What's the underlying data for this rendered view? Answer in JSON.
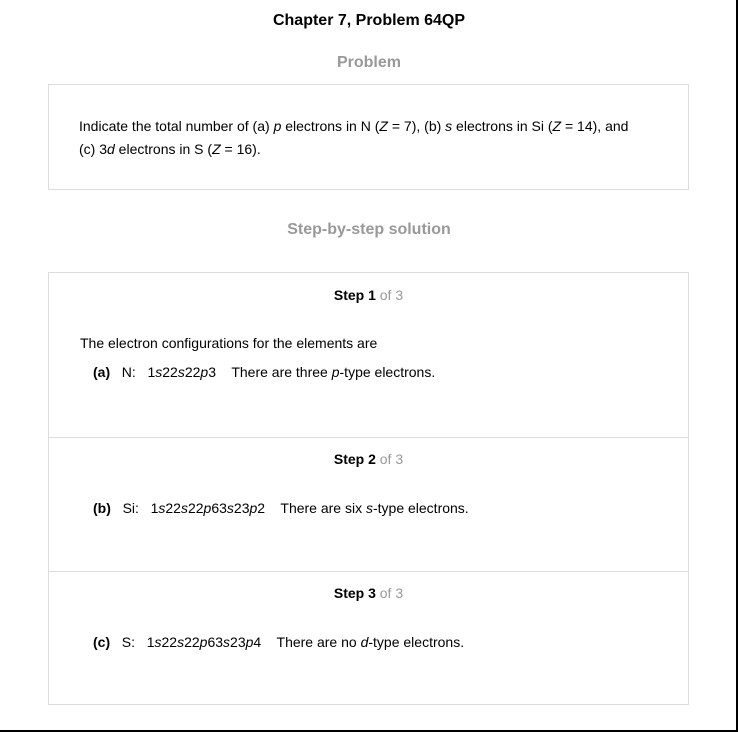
{
  "title": "Chapter 7, Problem 64QP",
  "problem_heading": "Problem",
  "problem": {
    "line1": {
      "t1": "Indicate the total number of (a) ",
      "p": "p",
      "t2": " electrons in N (",
      "z1": "Z",
      "t3": " = 7), (b) ",
      "s": "s",
      "t4": " electrons in Si (",
      "z2": "Z",
      "t5": " = 14), and"
    },
    "line2": {
      "t1": "(c) 3",
      "d": "d",
      "t2": " electrons in S (",
      "z3": "Z",
      "t3": " = 16)."
    }
  },
  "solution_heading": "Step-by-step solution",
  "steps": [
    {
      "word": "Step 1",
      "total": " of 3",
      "intro": "The electron configurations for the elements are",
      "config": {
        "label": "(a)",
        "element": "N:",
        "c1": "1",
        "c2": "s",
        "c3": "22",
        "c4": "s",
        "c5": "22",
        "c6": "p",
        "c7": "3",
        "statement_pre": "There are three ",
        "statement_type": "p",
        "statement_post": "-type electrons."
      }
    },
    {
      "word": "Step 2",
      "total": " of 3",
      "config": {
        "label": "(b)",
        "element": "Si:",
        "c1": "1",
        "c2": "s",
        "c3": "22",
        "c4": "s",
        "c5": "22",
        "c6": "p",
        "c7": "63",
        "c8": "s",
        "c9": "23",
        "c10": "p",
        "c11": "2",
        "statement_pre": "There are six ",
        "statement_type": "s",
        "statement_post": "-type electrons."
      }
    },
    {
      "word": "Step 3",
      "total": " of 3",
      "config": {
        "label": "(c)",
        "element": "S:",
        "c1": "1",
        "c2": "s",
        "c3": "22",
        "c4": "s",
        "c5": "22",
        "c6": "p",
        "c7": "63",
        "c8": "s",
        "c9": "23",
        "c10": "p",
        "c11": "4",
        "statement_pre": "There are no ",
        "statement_type": "d",
        "statement_post": "-type electrons."
      }
    }
  ]
}
